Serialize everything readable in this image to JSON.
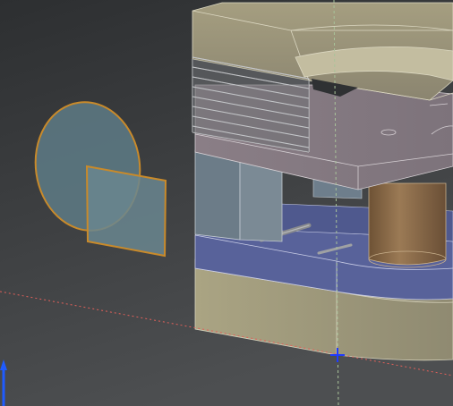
{
  "viewport": {
    "background_top": "#2f3133",
    "background_bottom": "#4a4c4e"
  },
  "colors": {
    "selection_orange": "#c98a2a",
    "sketch_fill": "#5f7b84",
    "base_plate": "#b3ad8c",
    "blue_block": "#5a6498",
    "top_plate": "#8d8088",
    "bronze_cylinder": "#8a6a48",
    "spring_coil": "#6d6f73",
    "guide_line_green": "#a9c39a",
    "guide_line_red": "#e0605a",
    "cursor_blue": "#1f3cff"
  },
  "icons": {
    "axis_triad": "z-axis-triad-icon",
    "cursor": "crosshair-cursor-icon"
  }
}
